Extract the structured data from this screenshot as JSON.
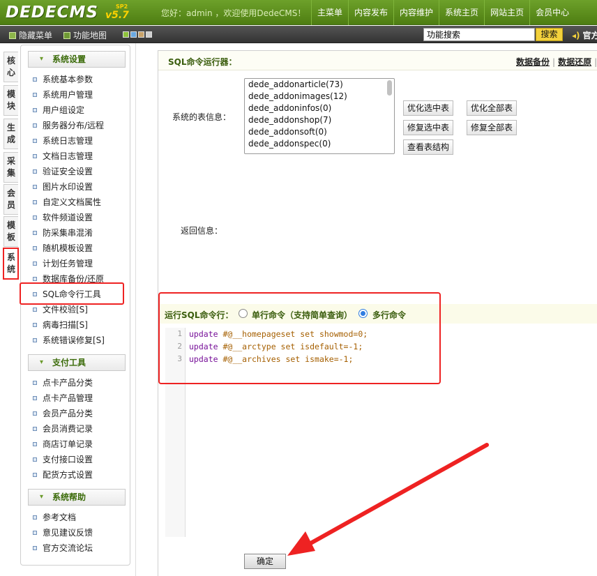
{
  "header": {
    "logo_text": "DEDECMS",
    "logo_version": "v5.7",
    "logo_edition": "SP2",
    "welcome": "您好：admin ，欢迎使用DedeCMS！",
    "nav": [
      "主菜单",
      "内容发布",
      "内容维护",
      "系统主页",
      "网站主页",
      "会员中心"
    ]
  },
  "toolbar": {
    "hide_menu": "隐藏菜单",
    "function_map": "功能地图",
    "search_value": "功能搜索",
    "search_button": "搜索",
    "official": "官方"
  },
  "vtabs": [
    {
      "label": "核心",
      "active": false
    },
    {
      "label": "模块",
      "active": false
    },
    {
      "label": "生成",
      "active": false
    },
    {
      "label": "采集",
      "active": false
    },
    {
      "label": "会员",
      "active": false
    },
    {
      "label": "模板",
      "active": false
    },
    {
      "label": "系统",
      "active": true
    }
  ],
  "sidebar": {
    "system_settings": {
      "title": "系统设置",
      "items": [
        "系统基本参数",
        "系统用户管理",
        "用户组设定",
        "服务器分布/远程",
        "系统日志管理",
        "文档日志管理",
        "验证安全设置",
        "图片水印设置",
        "自定义文档属性",
        "软件频道设置",
        "防采集串混淆",
        "随机模板设置",
        "计划任务管理",
        "数据库备份/还原",
        "SQL命令行工具",
        "文件校验[S]",
        "病毒扫描[S]",
        "系统错误修复[S]"
      ]
    },
    "payment_tools": {
      "title": "支付工具",
      "items": [
        "点卡产品分类",
        "点卡产品管理",
        "会员产品分类",
        "会员消费记录",
        "商店订单记录",
        "支付接口设置",
        "配货方式设置"
      ]
    },
    "system_help": {
      "title": "系统帮助",
      "items": [
        "参考文档",
        "意见建议反馈",
        "官方交流论坛"
      ]
    }
  },
  "content": {
    "title": "SQL命令运行器：",
    "backup_link": "数据备份",
    "restore_link": "数据还原",
    "table_info_label": "系统的表信息：",
    "tables": [
      "dede_addonarticle(73)",
      "dede_addonimages(12)",
      "dede_addoninfos(0)",
      "dede_addonshop(7)",
      "dede_addonsoft(0)",
      "dede_addonspec(0)"
    ],
    "buttons": {
      "optimize_selected": "优化选中表",
      "optimize_all": "优化全部表",
      "repair_selected": "修复选中表",
      "repair_all": "修复全部表",
      "view_structure": "查看表结构"
    },
    "return_label": "返回信息：",
    "run_label": "运行SQL命令行：",
    "mode_single": "单行命令（支持简单查询）",
    "mode_multi": "多行命令",
    "selected_mode": "multi",
    "sql_lines": [
      {
        "num": "1",
        "kw": "update",
        "rest": " #@__homepageset set showmod=0;"
      },
      {
        "num": "2",
        "kw": "update",
        "rest": " #@__arctype set isdefault=-1;"
      },
      {
        "num": "3",
        "kw": "update",
        "rest": " #@__archives set ismake=-1;"
      }
    ],
    "submit": "确定"
  },
  "colors": {
    "header_green": "#5a8f1c",
    "accent_red": "#e22222",
    "label_green": "#3a5d0d",
    "search_yellow": "#f3d13c"
  }
}
